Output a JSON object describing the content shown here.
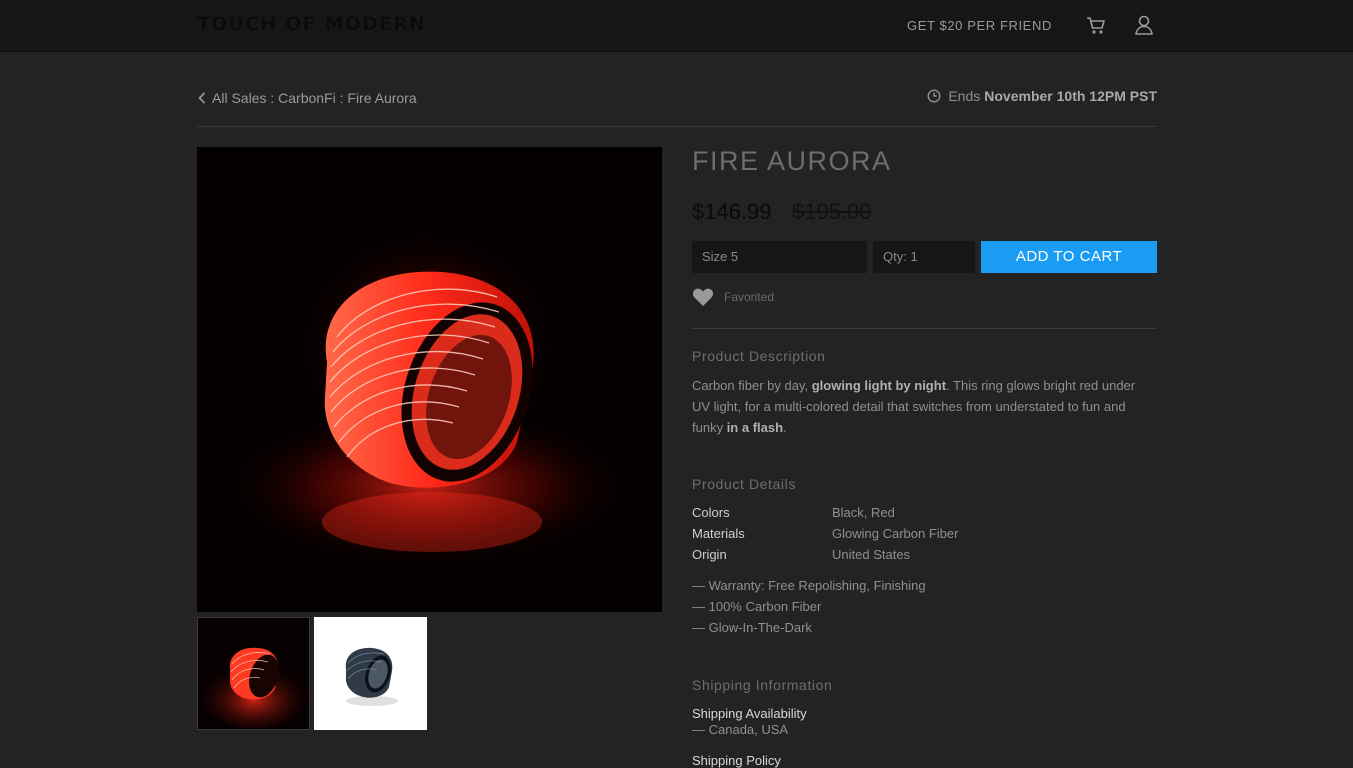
{
  "header": {
    "logo": "TOUCH OF MODERN",
    "referral": "GET $20 PER FRIEND",
    "cart_icon": "cart-icon",
    "user_icon": "user-icon"
  },
  "breadcrumb": {
    "text": "All Sales : CarbonFi : Fire Aurora"
  },
  "sale_end": {
    "prefix": "Ends",
    "date": "November 10th 12PM PST"
  },
  "product": {
    "title": "FIRE AURORA",
    "price": "$146.99",
    "original_price": "$195.00",
    "size_select": "Size 5",
    "qty_select": "Qty: 1",
    "add_to_cart": "ADD TO CART",
    "favorite_label": "Favorited",
    "images": [
      "glowing red ring",
      "carbon fiber ring"
    ]
  },
  "description": {
    "heading": "Product Description",
    "part1": "Carbon fiber by day, ",
    "bold1": "glowing light by night",
    "part2": ". This ring glows bright red under UV light, for a multi-colored detail that switches from understated to fun and funky ",
    "bold2": "in a flash",
    "part3": "."
  },
  "details": {
    "heading": "Product Details",
    "specs": [
      {
        "label": "Colors",
        "value": "Black, Red"
      },
      {
        "label": "Materials",
        "value": "Glowing Carbon Fiber"
      },
      {
        "label": "Origin",
        "value": "United States"
      }
    ],
    "bullets": [
      "— Warranty: Free Repolishing, Finishing",
      "— 100% Carbon Fiber",
      "— Glow-In-The-Dark"
    ]
  },
  "shipping": {
    "heading": "Shipping Information",
    "availability_label": "Shipping Availability",
    "availability_value": "— Canada, USA",
    "policy_label": "Shipping Policy"
  },
  "colors": {
    "accent": "#1a9cf4",
    "background": "#232323",
    "header": "#161616"
  }
}
